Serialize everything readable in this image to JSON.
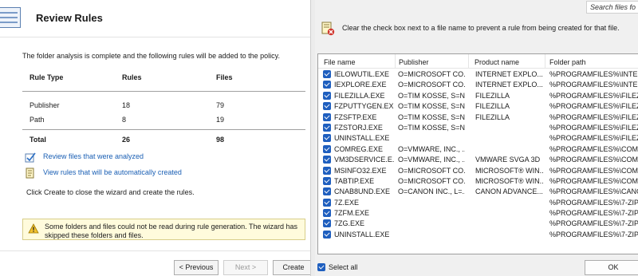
{
  "wizard": {
    "title": "Review Rules",
    "intro": "The folder analysis is complete and the following rules will be added to the policy.",
    "table": {
      "headers": [
        "Rule Type",
        "Rules",
        "Files"
      ],
      "rows": [
        [
          "Publisher",
          "18",
          "79"
        ],
        [
          "Path",
          "8",
          "19"
        ]
      ],
      "total": [
        "Total",
        "26",
        "98"
      ]
    },
    "link_review": "Review files that were analyzed",
    "link_view": "View rules that will be automatically created",
    "close_text": "Click Create to close the wizard and create the rules.",
    "warning": "Some folders and files could not be read during rule generation. The wizard has skipped these folders and files.",
    "buttons": {
      "previous": "< Previous",
      "next": "Next >",
      "create": "Create"
    }
  },
  "dialog": {
    "search_placeholder": "Search files fo",
    "hint": "Clear the check box next to a file name to prevent a rule from being created for that file.",
    "columns": [
      "File name",
      "Publisher",
      "Product name",
      "Folder path"
    ],
    "files": [
      [
        "IELOWUTIL.EXE",
        "O=MICROSOFT CO...",
        "INTERNET EXPLO...",
        "%PROGRAMFILES%\\INTERN"
      ],
      [
        "IEXPLORE.EXE",
        "O=MICROSOFT CO...",
        "INTERNET EXPLO...",
        "%PROGRAMFILES%\\INTERN"
      ],
      [
        "FILEZILLA.EXE",
        "O=TIM KOSSE, S=N...",
        "FILEZILLA",
        "%PROGRAMFILES%\\FILEZIL"
      ],
      [
        "FZPUTTYGEN.EXE",
        "O=TIM KOSSE, S=N...",
        "FILEZILLA",
        "%PROGRAMFILES%\\FILEZIL"
      ],
      [
        "FZSFTP.EXE",
        "O=TIM KOSSE, S=N...",
        "FILEZILLA",
        "%PROGRAMFILES%\\FILEZIL"
      ],
      [
        "FZSTORJ.EXE",
        "O=TIM KOSSE, S=N...",
        "",
        "%PROGRAMFILES%\\FILEZIL"
      ],
      [
        "UNINSTALL.EXE",
        "",
        "",
        "%PROGRAMFILES%\\FILEZIL"
      ],
      [
        "COMREG.EXE",
        "O=VMWARE, INC., ...",
        "",
        "%PROGRAMFILES%\\COMMO"
      ],
      [
        "VM3DSERVICE.E...",
        "O=VMWARE, INC., ...",
        "VMWARE SVGA 3D",
        "%PROGRAMFILES%\\COMMO"
      ],
      [
        "MSINFO32.EXE",
        "O=MICROSOFT CO...",
        "MICROSOFT® WIN...",
        "%PROGRAMFILES%\\COMMO"
      ],
      [
        "TABTIP.EXE",
        "O=MICROSOFT CO...",
        "MICROSOFT® WIN...",
        "%PROGRAMFILES%\\COMMO"
      ],
      [
        "CNAB8UND.EXE",
        "O=CANON INC., L=...",
        "CANON ADVANCE...",
        "%PROGRAMFILES%\\CANON"
      ],
      [
        "7Z.EXE",
        "",
        "",
        "%PROGRAMFILES%\\7-ZIP"
      ],
      [
        "7ZFM.EXE",
        "",
        "",
        "%PROGRAMFILES%\\7-ZIP"
      ],
      [
        "7ZG.EXE",
        "",
        "",
        "%PROGRAMFILES%\\7-ZIP"
      ],
      [
        "UNINSTALL.EXE",
        "",
        "",
        "%PROGRAMFILES%\\7-ZIP"
      ]
    ],
    "select_all": "Select all",
    "ok": "OK"
  }
}
